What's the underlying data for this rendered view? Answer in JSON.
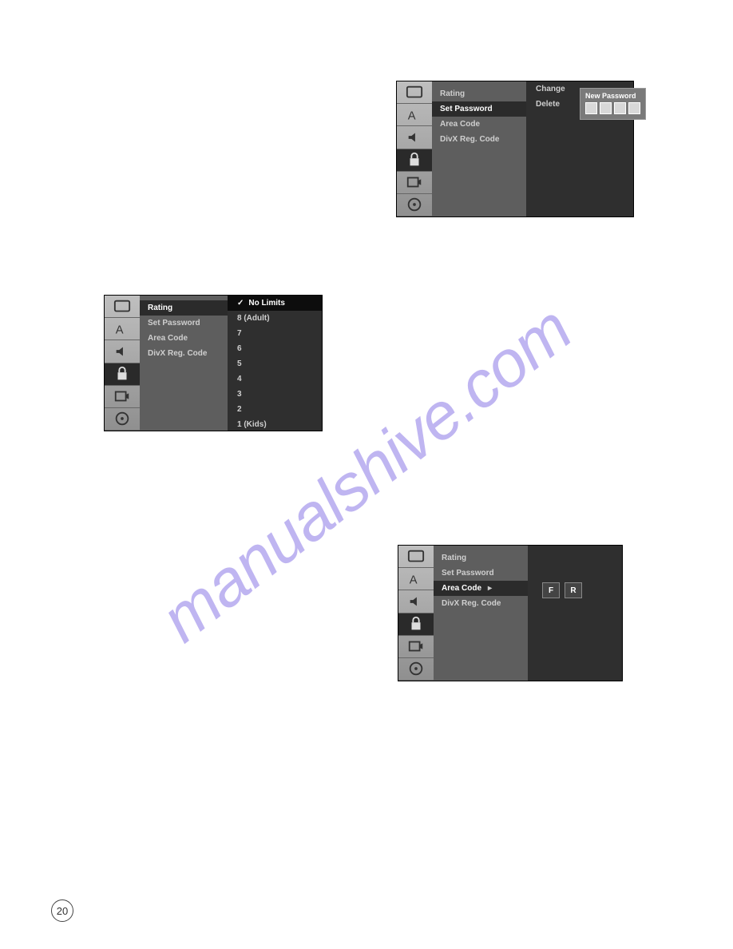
{
  "watermark": "manualshive.com",
  "page_number": "20",
  "menu_labels": {
    "rating": "Rating",
    "set_password": "Set Password",
    "area_code": "Area Code",
    "divx": "DivX Reg. Code"
  },
  "password_popup": {
    "title": "New Password",
    "change": "Change",
    "delete": "Delete"
  },
  "rating_options": {
    "no_limits": "No Limits",
    "adult": "8 (Adult)",
    "r7": "7",
    "r6": "6",
    "r5": "5",
    "r4": "4",
    "r3": "3",
    "r2": "2",
    "kids": "1 (Kids)"
  },
  "area_code": {
    "c1": "F",
    "c2": "R"
  }
}
